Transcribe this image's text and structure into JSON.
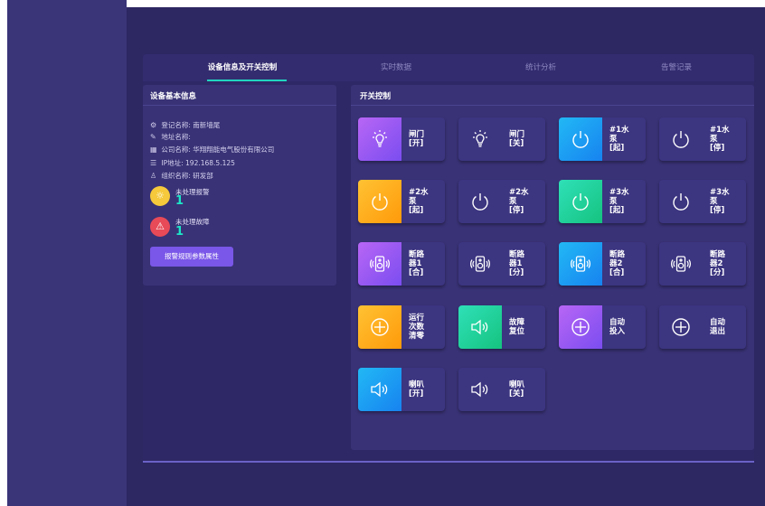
{
  "tabs": [
    "设备信息及开关控制",
    "实时数据",
    "统计分析",
    "告警记录"
  ],
  "info_panel": {
    "title": "设备基本信息",
    "lines": [
      {
        "icon": "gear-icon",
        "text": "登记名称: 南新墙尾"
      },
      {
        "icon": "edit-icon",
        "text": "地址名称:"
      },
      {
        "icon": "building-icon",
        "text": "公司名称: 华翔翔能电气股份有限公司"
      },
      {
        "icon": "list-icon",
        "text": "IP地址: 192.168.5.125"
      },
      {
        "icon": "user-icon",
        "text": "组织名称: 研发部"
      }
    ],
    "alarm_label": "未处理报警",
    "alarm_count": "1",
    "fault_label": "未处理故障",
    "fault_count": "1",
    "rules_button": "报警规则参数属性"
  },
  "control_panel": {
    "title": "开关控制",
    "buttons": [
      {
        "label": "闸门\n[开]",
        "icon": "bulb-icon",
        "color": "purple"
      },
      {
        "label": "闸门\n[关]",
        "icon": "bulb-icon",
        "color": "none"
      },
      {
        "label": "#1水\n泵\n[起]",
        "icon": "power-icon",
        "color": "blue"
      },
      {
        "label": "#1水\n泵\n[停]",
        "icon": "power-icon",
        "color": "none"
      },
      {
        "label": "#2水\n泵\n[起]",
        "icon": "power-icon",
        "color": "orange"
      },
      {
        "label": "#2水\n泵\n[停]",
        "icon": "power-icon",
        "color": "none"
      },
      {
        "label": "#3水\n泵\n[起]",
        "icon": "power-icon",
        "color": "green"
      },
      {
        "label": "#3水\n泵\n[停]",
        "icon": "power-icon",
        "color": "none"
      },
      {
        "label": "断路\n器1\n[合]",
        "icon": "speaker-icon",
        "color": "purple"
      },
      {
        "label": "断路\n器1\n[分]",
        "icon": "speaker-icon",
        "color": "none"
      },
      {
        "label": "断路\n器2\n[合]",
        "icon": "speaker-icon",
        "color": "blue"
      },
      {
        "label": "断路\n器2\n[分]",
        "icon": "speaker-icon",
        "color": "none"
      },
      {
        "label": "运行\n次数\n清零",
        "icon": "plus-circle-icon",
        "color": "orange"
      },
      {
        "label": "故障\n复位",
        "icon": "horn-icon",
        "color": "green"
      },
      {
        "label": "自动\n投入",
        "icon": "plus-circle-icon",
        "color": "purple"
      },
      {
        "label": "自动\n退出",
        "icon": "plus-circle-icon",
        "color": "none"
      },
      {
        "label": "喇叭\n[开]",
        "icon": "horn-icon",
        "color": "blue"
      },
      {
        "label": "喇叭\n[关]",
        "icon": "horn-icon",
        "color": "none"
      }
    ]
  },
  "colors": {
    "accent": "#21d5c0",
    "purple": "#9a5ef3",
    "blue": "#1f9ff3",
    "green": "#22d49c",
    "orange": "#ffb01f"
  }
}
